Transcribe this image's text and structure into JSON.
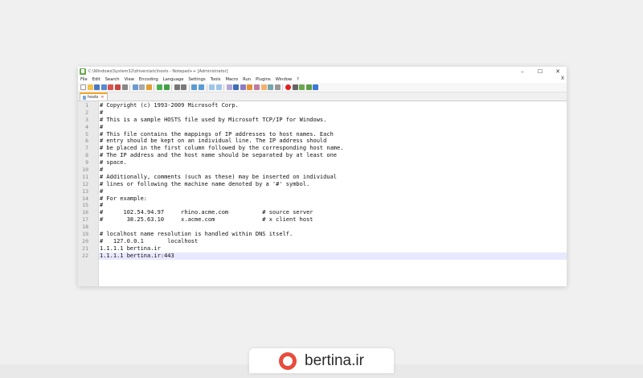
{
  "window": {
    "title": "C:\\Windows\\System32\\drivers\\etc\\hosts - Notepad++ [Administrator]",
    "controls": [
      "–",
      "☐",
      "✕"
    ]
  },
  "menu": [
    "File",
    "Edit",
    "Search",
    "View",
    "Encoding",
    "Language",
    "Settings",
    "Tools",
    "Macro",
    "Run",
    "Plugins",
    "Window",
    "?"
  ],
  "menu_close": "X",
  "tab": {
    "label": "hosts",
    "close": "✕"
  },
  "editor": {
    "line_numbers": [
      "1",
      "2",
      "3",
      "4",
      "5",
      "6",
      "7",
      "8",
      "9",
      "10",
      "11",
      "12",
      "13",
      "14",
      "15",
      "16",
      "17",
      "18",
      "19",
      "20",
      "21",
      "22"
    ],
    "lines": [
      "# Copyright (c) 1993-2009 Microsoft Corp.",
      "#",
      "# This is a sample HOSTS file used by Microsoft TCP/IP for Windows.",
      "#",
      "# This file contains the mappings of IP addresses to host names. Each",
      "# entry should be kept on an individual line. The IP address should",
      "# be placed in the first column followed by the corresponding host name.",
      "# The IP address and the host name should be separated by at least one",
      "# space.",
      "#",
      "# Additionally, comments (such as these) may be inserted on individual",
      "# lines or following the machine name denoted by a '#' symbol.",
      "#",
      "# For example:",
      "#",
      "#      102.54.94.97     rhino.acme.com          # source server",
      "#       38.25.63.10     x.acme.com              # x client host",
      "",
      "# localhost name resolution is handled within DNS itself.",
      "#   127.0.0.1       localhost",
      "1.1.1.1 bertina.ir",
      "1.1.1.1 bertina.ir:443"
    ],
    "current_line": 22
  },
  "brand": {
    "name": "bertina.ir"
  },
  "colors": {
    "accent_tab": "#f5a623",
    "current_line": "#e8e8ff",
    "brand_logo": "#e74c3c"
  }
}
